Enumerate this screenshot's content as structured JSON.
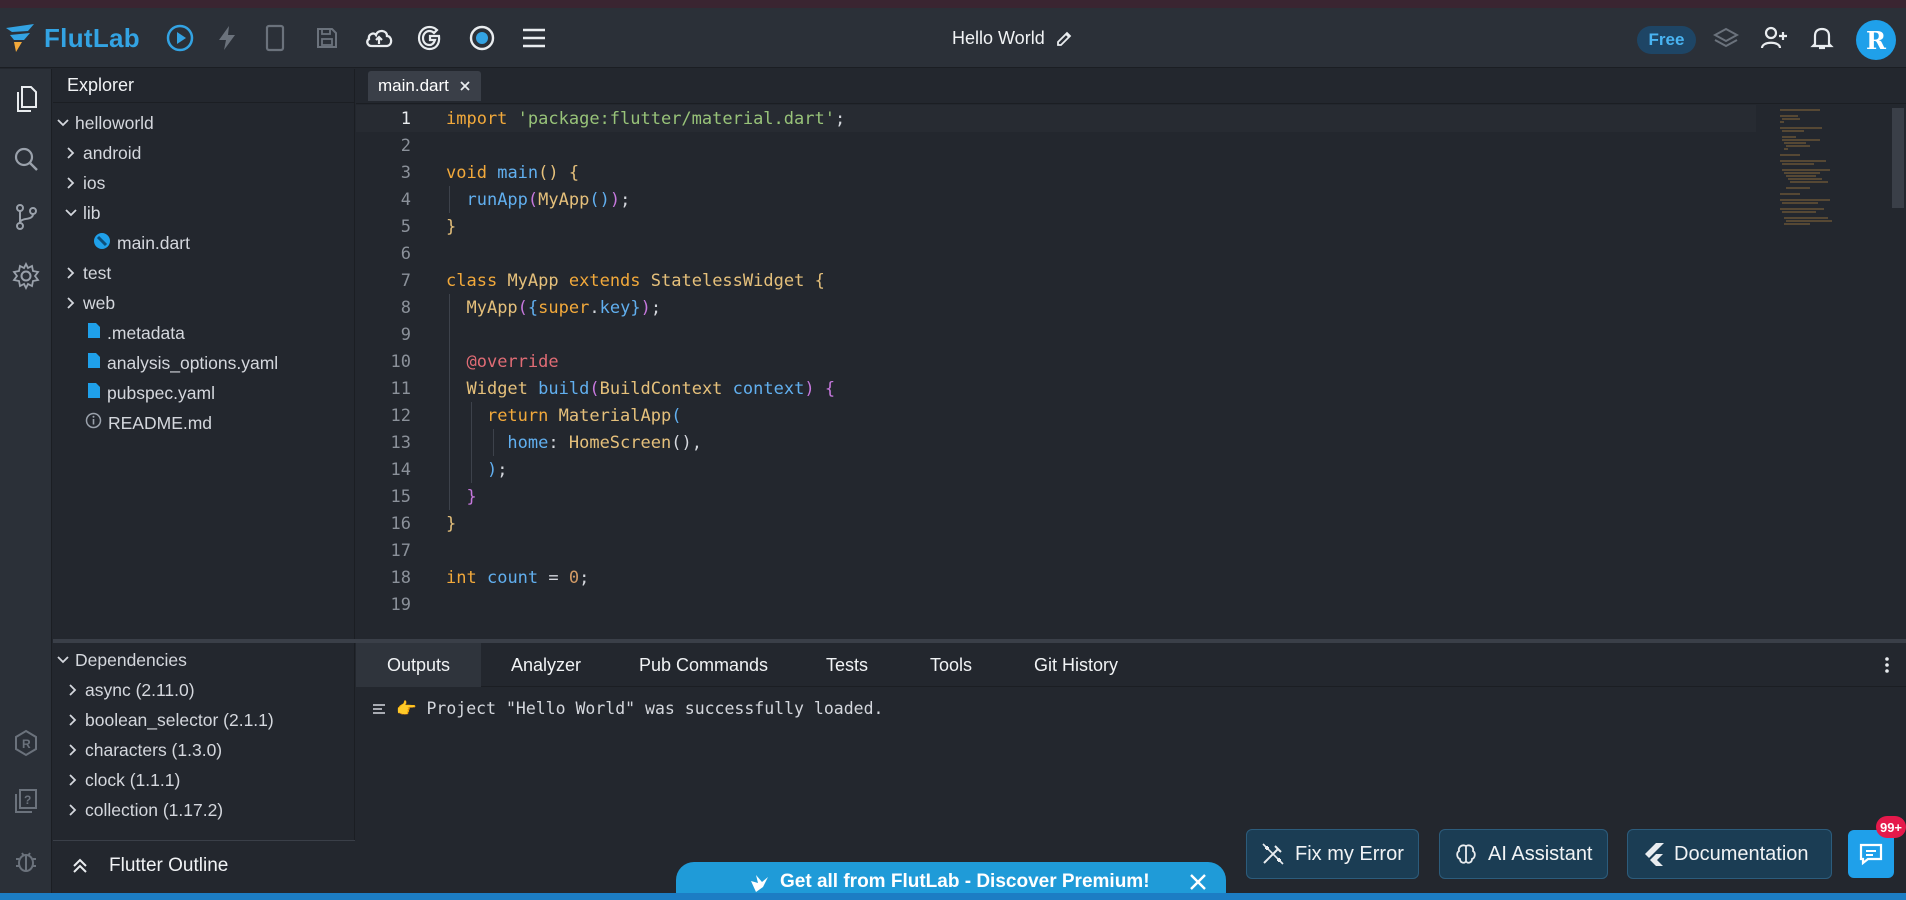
{
  "app": {
    "name": "FlutLab",
    "project_title": "Hello World",
    "plan_badge": "Free",
    "avatar_letter": "R"
  },
  "toolbar": {
    "icons": [
      "run-icon",
      "hot-reload-icon",
      "device-icon",
      "save-icon",
      "cloud-upload-icon",
      "google-icon",
      "record-icon",
      "menu-icon"
    ],
    "right_icons": [
      "layers-icon",
      "add-user-icon",
      "bell-icon"
    ]
  },
  "activity": [
    "files-icon",
    "search-icon",
    "git-branch-icon",
    "settings-icon",
    "r-icon",
    "help-icon",
    "bug-icon"
  ],
  "explorer": {
    "title": "Explorer",
    "items": [
      {
        "label": "helloworld"
      },
      {
        "label": "android"
      },
      {
        "label": "ios"
      },
      {
        "label": "lib"
      },
      {
        "label": "main.dart"
      },
      {
        "label": "test"
      },
      {
        "label": "web"
      },
      {
        "label": ".metadata"
      },
      {
        "label": "analysis_options.yaml"
      },
      {
        "label": "pubspec.yaml"
      },
      {
        "label": "README.md"
      }
    ]
  },
  "dependencies": {
    "title": "Dependencies",
    "items": [
      "async (2.11.0)",
      "boolean_selector (2.1.1)",
      "characters (1.3.0)",
      "clock (1.1.1)",
      "collection (1.17.2)"
    ]
  },
  "outline": {
    "title": "Flutter Outline"
  },
  "editor": {
    "tab": "main.dart",
    "lines": [
      {
        "n": "1",
        "code": "import 'package:flutter/material.dart';"
      },
      {
        "n": "2",
        "code": ""
      },
      {
        "n": "3",
        "code": "void main() {"
      },
      {
        "n": "4",
        "code": "  runApp(MyApp());"
      },
      {
        "n": "5",
        "code": "}"
      },
      {
        "n": "6",
        "code": ""
      },
      {
        "n": "7",
        "code": "class MyApp extends StatelessWidget {"
      },
      {
        "n": "8",
        "code": "  MyApp({super.key});"
      },
      {
        "n": "9",
        "code": ""
      },
      {
        "n": "10",
        "code": "  @override"
      },
      {
        "n": "11",
        "code": "  Widget build(BuildContext context) {"
      },
      {
        "n": "12",
        "code": "    return MaterialApp("
      },
      {
        "n": "13",
        "code": "      home: HomeScreen(),"
      },
      {
        "n": "14",
        "code": "    );"
      },
      {
        "n": "15",
        "code": "  }"
      },
      {
        "n": "16",
        "code": "}"
      },
      {
        "n": "17",
        "code": ""
      },
      {
        "n": "18",
        "code": "int count = 0;"
      },
      {
        "n": "19",
        "code": ""
      }
    ]
  },
  "panel": {
    "tabs": [
      "Outputs",
      "Analyzer",
      "Pub Commands",
      "Tests",
      "Tools",
      "Git History"
    ],
    "output": "👉 Project \"Hello World\" was successfully loaded."
  },
  "actions": {
    "fix": "Fix my Error",
    "ai": "AI Assistant",
    "docs": "Documentation",
    "badge": "99+"
  },
  "premium": {
    "text": "Get all from FlutLab - Discover Premium!"
  },
  "colors": {
    "accent": "#1fa0ea",
    "bg": "#23272e",
    "bar": "#2b3038",
    "keyword": "#f2a93b",
    "string": "#98c379",
    "func": "#61afef",
    "anno": "#e06c75"
  }
}
